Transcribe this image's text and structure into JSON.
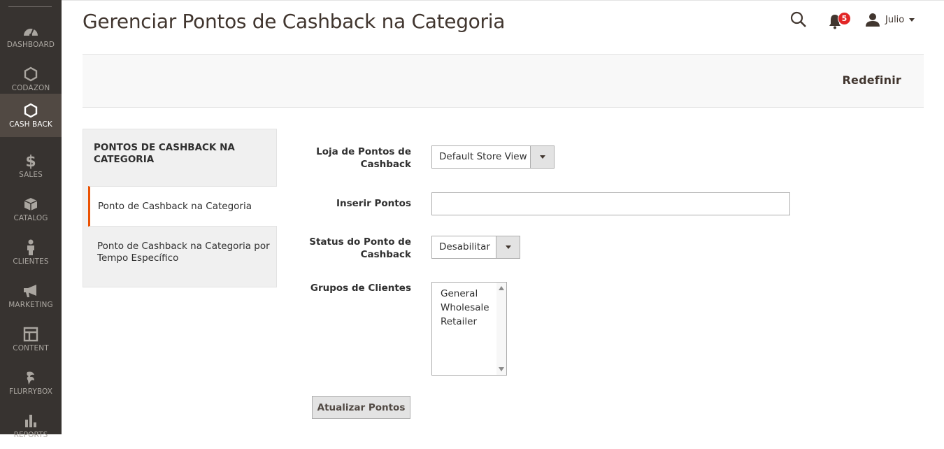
{
  "sidebar": {
    "items": [
      {
        "label": "DASHBOARD",
        "icon": "dashboard-icon"
      },
      {
        "label": "CODAZON",
        "icon": "hexagon-icon"
      },
      {
        "label": "CASH BACK",
        "icon": "hexagon-icon",
        "active": true
      },
      {
        "label": "SALES",
        "icon": "dollar-icon"
      },
      {
        "label": "CATALOG",
        "icon": "box-icon"
      },
      {
        "label": "CLIENTES",
        "icon": "person-icon"
      },
      {
        "label": "MARKETING",
        "icon": "megaphone-icon"
      },
      {
        "label": "CONTENT",
        "icon": "layout-icon"
      },
      {
        "label": "FLURRYBOX",
        "icon": "flurry-icon"
      },
      {
        "label": "REPORTS",
        "icon": "bar-chart-icon"
      }
    ]
  },
  "header": {
    "title": "Gerenciar Pontos de Cashback na Categoria",
    "notification_count": "5",
    "user_name": "Julio"
  },
  "action_bar": {
    "reset_label": "Redefinir"
  },
  "tabs": {
    "title": "PONTOS DE CASHBACK NA CATEGORIA",
    "items": [
      {
        "label": "Ponto de Cashback na Categoria",
        "active": true
      },
      {
        "label": "Ponto de Cashback na Categoria por Tempo Específico"
      }
    ]
  },
  "form": {
    "store_label": "Loja de Pontos de Cashback",
    "store_value": "Default Store View",
    "points_label": "Inserir Pontos",
    "points_value": "",
    "status_label": "Status do Ponto de Cashback",
    "status_value": "Desabilitar",
    "groups_label": "Grupos de Clientes",
    "groups_options": [
      "General",
      "Wholesale",
      "Retailer"
    ],
    "submit_label": "Atualizar Pontos"
  },
  "colors": {
    "sidebar_bg": "#373330",
    "sidebar_active": "#514943",
    "accent": "#eb5202",
    "badge": "#e22626"
  }
}
